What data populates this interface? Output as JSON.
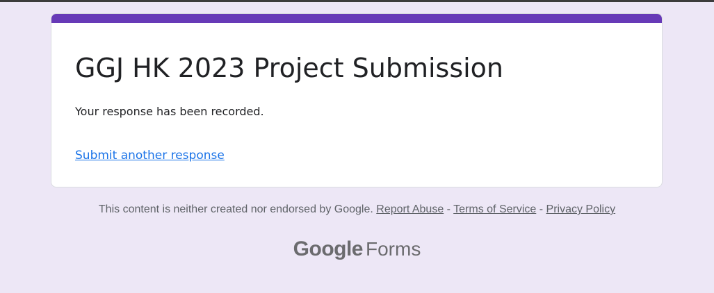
{
  "form": {
    "title": "GGJ HK 2023 Project Submission",
    "confirmation_message": "Your response has been recorded.",
    "submit_another_label": "Submit another response"
  },
  "footer": {
    "disclaimer": "This content is neither created nor endorsed by Google.",
    "report_abuse": "Report Abuse",
    "separator_1": " - ",
    "terms_of_service": "Terms of Service",
    "separator_2": " - ",
    "privacy_policy": "Privacy Policy"
  },
  "brand": {
    "google": "Google",
    "product": "Forms"
  },
  "colors": {
    "background": "#ede7f6",
    "accent": "#673ab7",
    "link": "#1a73e8",
    "text": "#202124",
    "muted": "#5f6368"
  }
}
